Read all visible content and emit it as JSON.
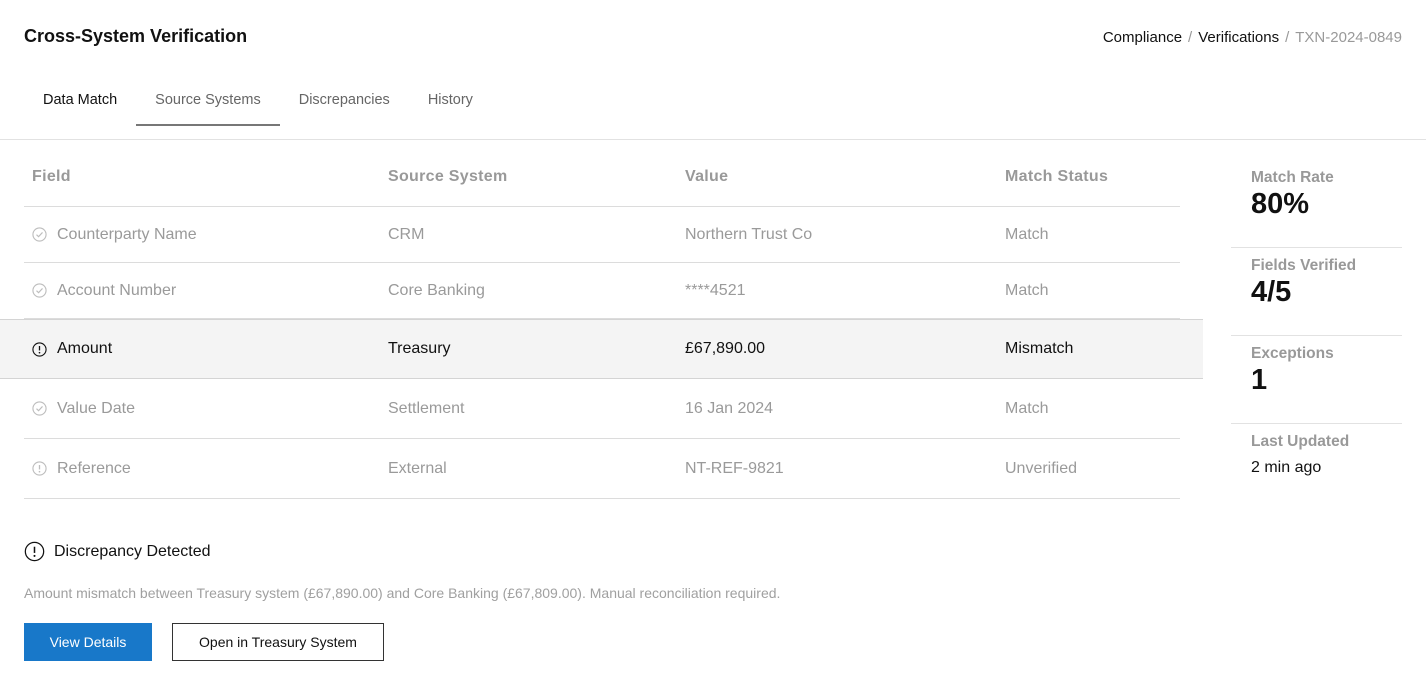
{
  "header": {
    "title": "Cross-System Verification",
    "breadcrumb": [
      "Compliance",
      "Verifications",
      "TXN-2024-0849"
    ]
  },
  "tabs": [
    {
      "label": "Data Match",
      "active": false
    },
    {
      "label": "Source Systems",
      "active": true
    },
    {
      "label": "Discrepancies",
      "active": false
    },
    {
      "label": "History",
      "active": false
    }
  ],
  "table": {
    "columns": [
      "Field",
      "Source System",
      "Value",
      "Match Status"
    ],
    "rows": [
      {
        "field": "Counterparty Name",
        "source": "CRM",
        "value": "Northern Trust Co",
        "status": "Match",
        "icon": "check-circle-icon"
      },
      {
        "field": "Account Number",
        "source": "Core Banking",
        "value": "****4521",
        "status": "Match",
        "icon": "check-circle-icon"
      },
      {
        "field": "Amount",
        "source": "Treasury",
        "value": "£67,890.00",
        "status": "Mismatch",
        "icon": "alert-circle-icon"
      },
      {
        "field": "Value Date",
        "source": "Settlement",
        "value": "16 Jan 2024",
        "status": "Match",
        "icon": "check-circle-icon"
      },
      {
        "field": "Reference",
        "source": "External",
        "value": "NT-REF-9821",
        "status": "Unverified",
        "icon": "alert-circle-icon"
      }
    ]
  },
  "stats": [
    {
      "label": "Match Rate",
      "value": "80%"
    },
    {
      "label": "Fields Verified",
      "value": "4/5"
    },
    {
      "label": "Exceptions",
      "value": "1"
    },
    {
      "label": "Last Updated",
      "value": "2 min ago"
    }
  ],
  "alert": {
    "title": "Discrepancy Detected",
    "message": "Amount mismatch between Treasury system (£67,890.00) and Core Banking (£67,809.00). Manual reconciliation required.",
    "icon": "alert-circle-icon"
  },
  "actions": {
    "primary": "View Details",
    "secondary": "Open in Treasury System"
  },
  "colors": {
    "primary": "#1878c9",
    "highlight_row": "#f4f4f4",
    "muted_text": "#9a9a9a"
  }
}
